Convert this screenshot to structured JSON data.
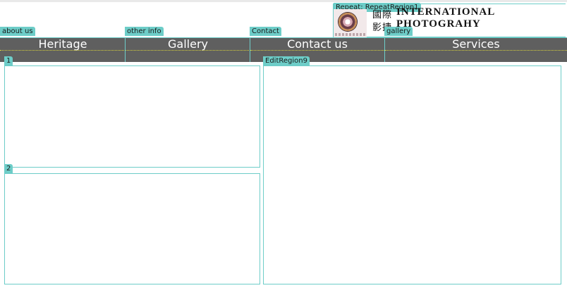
{
  "repeat_tag": "Repeat: RepeatRegion1",
  "logo": {
    "cjk_line1": "國際",
    "cjk_line2": "影捷",
    "line1": "INTERNATIONAL",
    "line2": "PHOTOGRAHY"
  },
  "nav_tags": {
    "about": "about us",
    "other": "other info",
    "contact": "Contact",
    "gallery": "gallery"
  },
  "nav": {
    "items": [
      "Heritage",
      "Gallery",
      "Contact us",
      "Services"
    ]
  },
  "regions": {
    "r1_label": "1",
    "r2_label": "2",
    "edit_label": "EditRegion9"
  },
  "colors": {
    "nav_bg": "#5f5f5f",
    "tag_bg": "#6dcdc8",
    "region_border": "#6dcdc8"
  }
}
